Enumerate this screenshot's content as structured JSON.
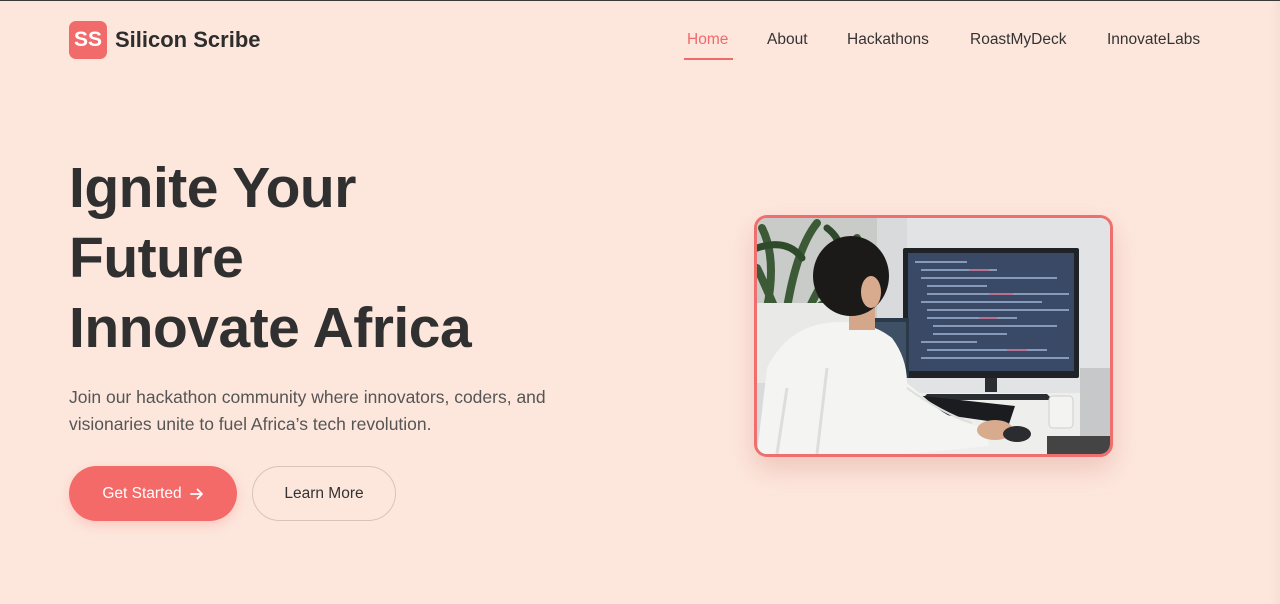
{
  "header": {
    "logo_badge": "SS",
    "brand_name": "Silicon Scribe",
    "nav": [
      {
        "label": "Home",
        "active": true
      },
      {
        "label": "About",
        "active": false
      },
      {
        "label": "Hackathons",
        "active": false
      },
      {
        "label": "RoastMyDeck",
        "active": false
      },
      {
        "label": "InnovateLabs",
        "active": false
      }
    ]
  },
  "hero": {
    "title_lines": [
      "Ignite Your",
      "Future",
      "Innovate Africa"
    ],
    "subtitle": "Join our hackathon community where innovators, coders, and visionaries unite to fuel Africa’s tech revolution.",
    "primary_button": {
      "label": "Get Started",
      "icon": "arrow-right-icon"
    },
    "secondary_button": {
      "label": "Learn More"
    }
  },
  "colors": {
    "background": "#fde7dd",
    "accent": "#f26b6b",
    "text": "#2f2f2f"
  }
}
